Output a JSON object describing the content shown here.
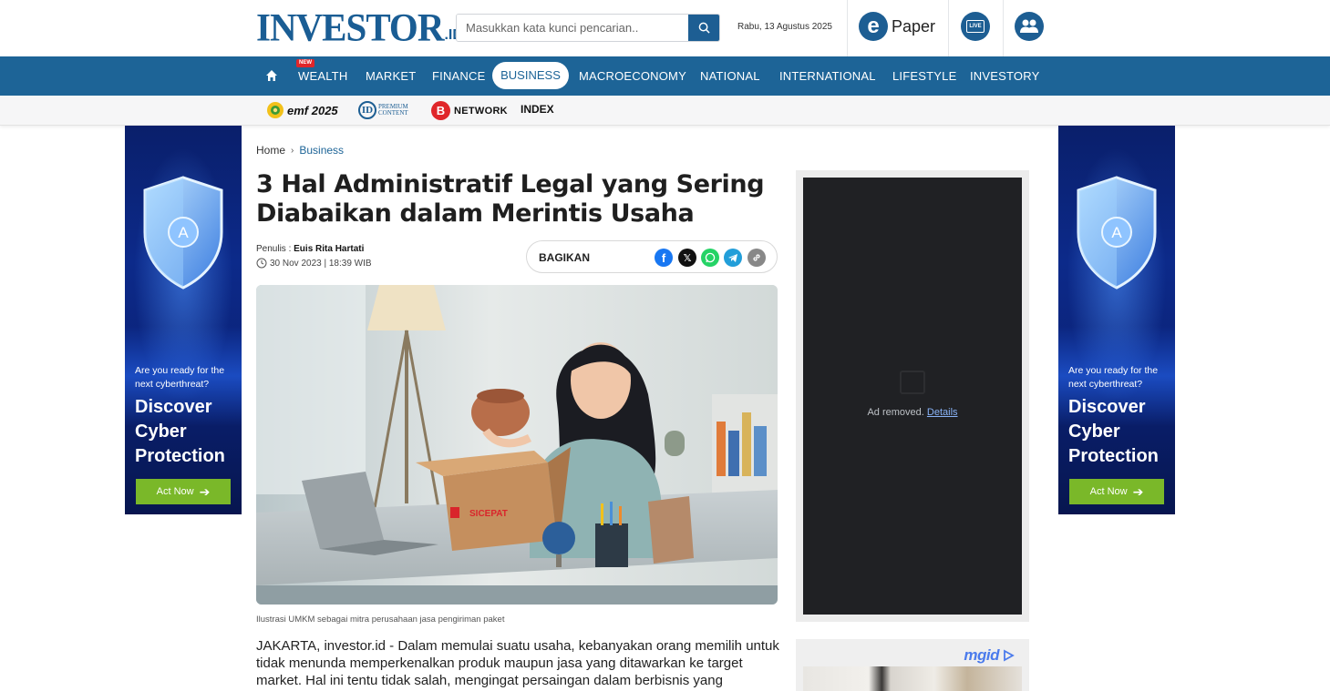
{
  "header": {
    "logo_main": "INVESTOR",
    "logo_sub": ".ID",
    "search_placeholder": "Masukkan kata kunci pencarian..",
    "date": "Rabu, 13 Agustus 2025",
    "epaper_letter": "e",
    "epaper_label": "Paper",
    "live_label": "LIVE"
  },
  "nav": {
    "items": [
      {
        "label": "WEALTH",
        "badge": "NEW"
      },
      {
        "label": "MARKET"
      },
      {
        "label": "FINANCE"
      },
      {
        "label": "BUSINESS",
        "active": true
      },
      {
        "label": "MACROECONOMY"
      },
      {
        "label": "NATIONAL"
      },
      {
        "label": "INTERNATIONAL"
      },
      {
        "label": "LIFESTYLE"
      },
      {
        "label": "INVESTORY"
      }
    ]
  },
  "subnav": {
    "emf_label": "emf 2025",
    "premium_badge": "ID",
    "premium_line1": "PREMIUM",
    "premium_line2": "CONTENT",
    "network_letter": "B",
    "network_label": "NETWORK",
    "index_label": "INDEX"
  },
  "side_ad": {
    "shield_letter": "A",
    "question": "Are you ready for the next cyberthreat?",
    "headline": "Discover Cyber Protection",
    "cta": "Act Now"
  },
  "article": {
    "breadcrumb": [
      "Home",
      "Business"
    ],
    "title": "3 Hal Administratif Legal yang Sering Diabaikan dalam Merintis Usaha",
    "author_prefix": "Penulis : ",
    "author": "Euis Rita Hartati",
    "timestamp": "30 Nov 2023 | 18:39 WIB",
    "share_label": "BAGIKAN",
    "image_box_label": "SICEPAT",
    "caption": "Ilustrasi UMKM sebagai mitra perusahaan jasa pengiriman paket",
    "body": "JAKARTA, investor.id - Dalam memulai suatu usaha, kebanyakan orang memilih untuk tidak menunda memperkenalkan produk maupun jasa yang ditawarkan ke target market. Hal ini tentu tidak salah, mengingat persaingan dalam berbisnis yang"
  },
  "right_column": {
    "ad_removed_text": "Ad removed.",
    "ad_removed_link": "Details",
    "mgid_label": "mgid"
  },
  "colors": {
    "brand_blue": "#1d6497",
    "facebook": "#1877f2",
    "x": "#111111",
    "whatsapp": "#25d366",
    "telegram": "#229ed9",
    "link": "#888888",
    "ad_cta": "#7ab829"
  }
}
